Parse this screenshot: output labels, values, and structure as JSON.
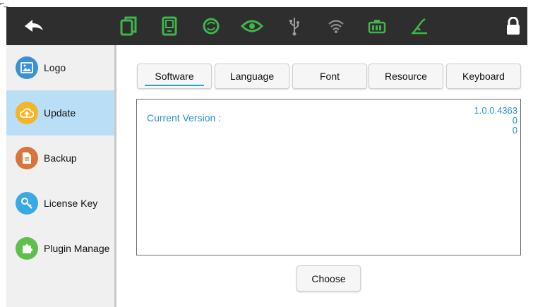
{
  "colors": {
    "topbar": "#2e2e2e",
    "accent_green": "#3fb54a",
    "selected_bg": "#b9def6",
    "value_blue": "#2a8fd0"
  },
  "topbar": {
    "icons": [
      "back-arrow-icon",
      "copy-screen-icon",
      "tablet-icon",
      "sync-icon",
      "eye-icon",
      "usb-icon",
      "wifi-icon",
      "battery-icon",
      "measure-icon",
      "lock-icon"
    ]
  },
  "sidebar": {
    "items": [
      {
        "label": "Logo",
        "icon": "image-icon",
        "color": "#3a8fd6"
      },
      {
        "label": "Update",
        "icon": "cloud-upload-icon",
        "color": "#f5b526",
        "active": true
      },
      {
        "label": "Backup",
        "icon": "backup-doc-icon",
        "color": "#d9743a"
      },
      {
        "label": "License Key",
        "icon": "key-icon",
        "color": "#3aa8e6"
      },
      {
        "label": "Plugin Manage",
        "icon": "puzzle-icon",
        "color": "#5cc04a"
      }
    ]
  },
  "tabs": [
    {
      "label": "Software",
      "active": true
    },
    {
      "label": "Language"
    },
    {
      "label": "Font"
    },
    {
      "label": "Resource"
    },
    {
      "label": "Keyboard"
    }
  ],
  "panel": {
    "current_version_label": "Current Version :",
    "values": [
      "1.0.0.4363",
      "0",
      "0"
    ]
  },
  "choose_button": {
    "label": "Choose"
  }
}
